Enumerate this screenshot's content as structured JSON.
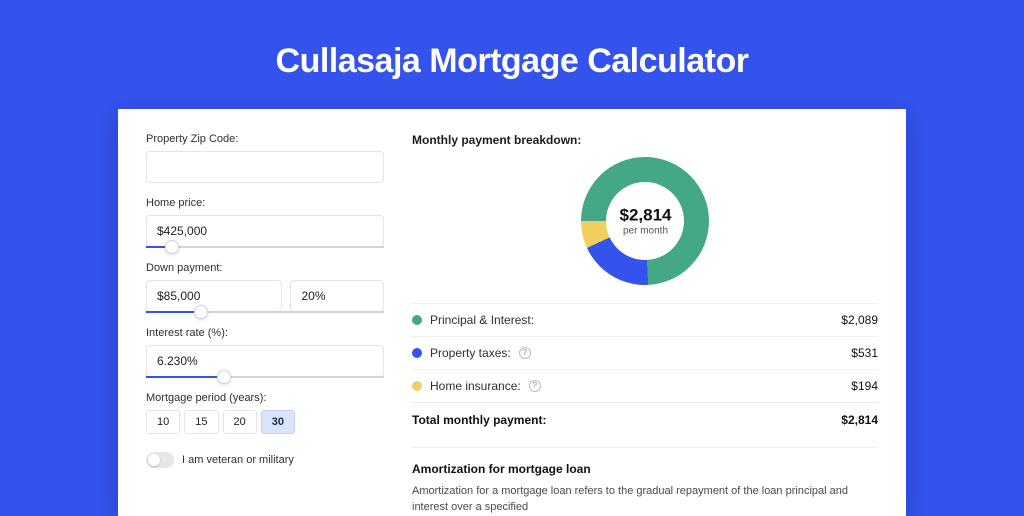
{
  "title": "Cullasaja Mortgage Calculator",
  "form": {
    "zip_label": "Property Zip Code:",
    "zip_value": "",
    "home_price_label": "Home price:",
    "home_price_value": "$425,000",
    "home_price_slider_pct": 8,
    "down_label": "Down payment:",
    "down_value": "$85,000",
    "down_pct_value": "20%",
    "down_slider_pct": 20,
    "rate_label": "Interest rate (%):",
    "rate_value": "6.230%",
    "rate_slider_pct": 30,
    "period_label": "Mortgage period (years):",
    "periods": [
      "10",
      "15",
      "20",
      "30"
    ],
    "period_selected_index": 3,
    "veteran_label": "I am veteran or military"
  },
  "breakdown": {
    "title": "Monthly payment breakdown:",
    "center_amount": "$2,814",
    "center_per": "per month",
    "colors": {
      "pi": "#44a887",
      "tax": "#3452ec",
      "ins": "#f0cf5e"
    },
    "items": [
      {
        "key": "pi",
        "label": "Principal & Interest:",
        "value": "$2,089",
        "help": false
      },
      {
        "key": "tax",
        "label": "Property taxes:",
        "value": "$531",
        "help": true
      },
      {
        "key": "ins",
        "label": "Home insurance:",
        "value": "$194",
        "help": true
      }
    ],
    "total_label": "Total monthly payment:",
    "total_value": "$2,814"
  },
  "amort": {
    "title": "Amortization for mortgage loan",
    "text": "Amortization for a mortgage loan refers to the gradual repayment of the loan principal and interest over a specified"
  },
  "chart_data": {
    "type": "pie",
    "title": "Monthly payment breakdown",
    "categories": [
      "Principal & Interest",
      "Property taxes",
      "Home insurance"
    ],
    "values": [
      2089,
      531,
      194
    ],
    "total": 2814,
    "series": [
      {
        "name": "Principal & Interest",
        "value": 2089,
        "degrees": 267.2,
        "color": "#44a887"
      },
      {
        "name": "Property taxes",
        "value": 531,
        "degrees": 67.9,
        "color": "#3452ec"
      },
      {
        "name": "Home insurance",
        "value": 194,
        "degrees": 24.8,
        "color": "#f0cf5e"
      }
    ]
  }
}
